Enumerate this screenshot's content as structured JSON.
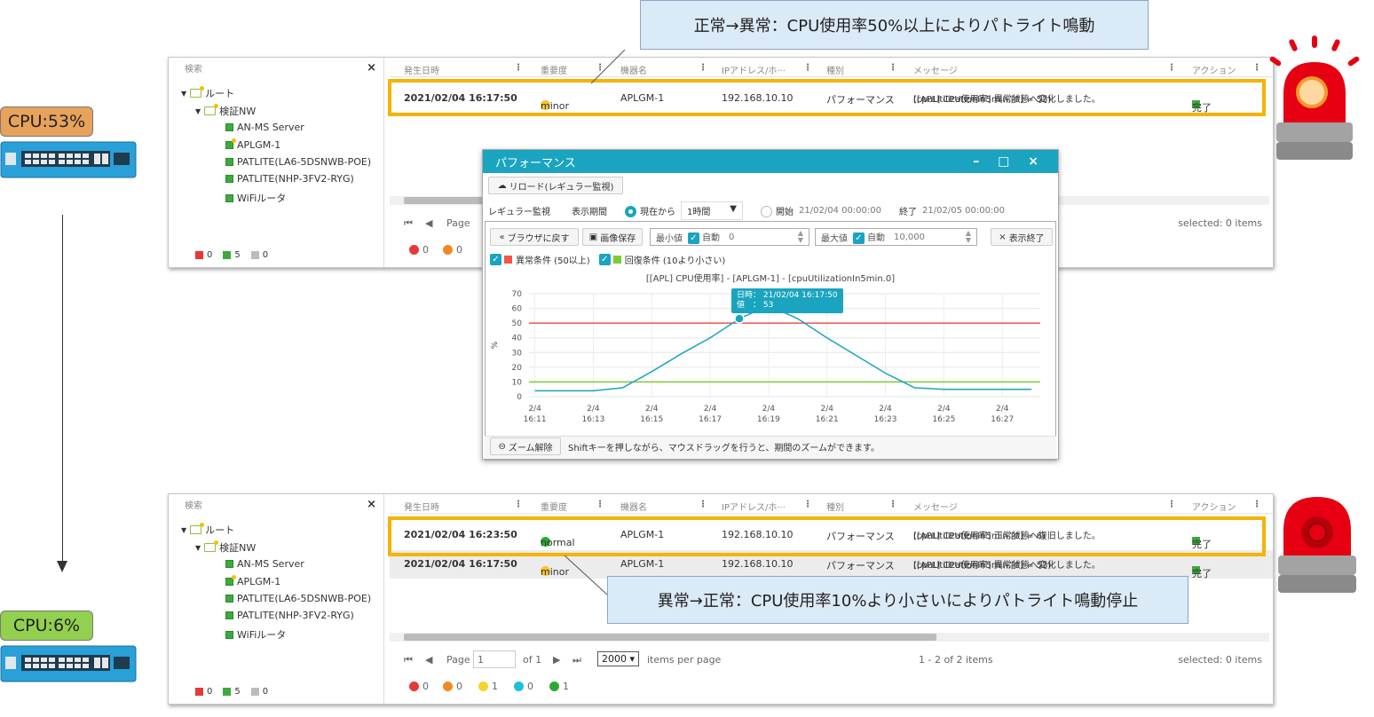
{
  "callout_top": "正常→異常：CPU使用率50%以上によりパトライト鳴動",
  "callout_bottom": "異常→正常：CPU使用率10%より小さいによりパトライト鳴動停止",
  "cpu_top": "CPU:53%",
  "cpu_bottom": "CPU:6%",
  "colors": {
    "cpu_top": "#e7a25c",
    "cpu_bottom": "#92d050",
    "highlight": "#f4b400",
    "accent": "#1aa4c0"
  },
  "tree": {
    "search": "検索",
    "close": "×",
    "root": "ルート",
    "group": "検証NW",
    "items": [
      "AN-MS Server",
      "APLGM-1",
      "PATLITE(LA6-5DSNWB-POE)",
      "PATLITE(NHP-3FV2-RYG)",
      "WiFiルータ"
    ],
    "foot": [
      "0",
      "5",
      "0"
    ]
  },
  "grid": {
    "headers": [
      "発生日時",
      "重要度",
      "機器名",
      "IPアドレス/ホ···",
      "種別",
      "メッセージ",
      "アクション"
    ],
    "col_menu": "⋮"
  },
  "top_row": {
    "datetime": "2021/02/04 16:17:50",
    "severity": "minor",
    "device": "APLGM-1",
    "ip": "192.168.10.10",
    "type": "パフォーマンス",
    "msg1": "[[APL] CPU使用率] 異常状態へ変化しました。",
    "msg2": "(cpuUtilizationIn5min.[0] = 53)",
    "action": "完了"
  },
  "bottom_rows": [
    {
      "datetime": "2021/02/04 16:23:50",
      "severity": "normal",
      "device": "APLGM-1",
      "ip": "192.168.10.10",
      "type": "パフォーマンス",
      "msg1": "[[APL] CPU使用率] 正常状態へ復旧しました。",
      "msg2": "(cpuUtilizationIn5min.[0] = 6)",
      "action": "完了"
    },
    {
      "datetime": "2021/02/04 16:17:50",
      "severity": "minor",
      "device": "APLGM-1",
      "ip": "192.168.10.10",
      "type": "パフォーマンス",
      "msg1": "[[APL] CPU使用率] 異常状態へ変化しました。",
      "msg2": "(cpuUtilizationIn5min.[0] = 53)",
      "action": "完了"
    }
  ],
  "pager": {
    "page_label": "Page",
    "page_value": "1",
    "of_label": "of 1",
    "per_page": "2000",
    "per_page_label": "items per page",
    "count": "1 - 2 of 2 items",
    "selected": "selected: 0 items"
  },
  "status_counts": [
    "0",
    "0",
    "1",
    "0",
    "1"
  ],
  "perf": {
    "title": "パフォーマンス",
    "window_controls": "– □ ×",
    "reload": "リロード(レギュラー監視)",
    "regular": "レギュラー監視",
    "period_label": "表示期間",
    "from_now": "現在から",
    "range": "1時間",
    "start_label": "開始",
    "start": "21/02/04 00:00:00",
    "end_label": "終了",
    "end": "21/02/05 00:00:00",
    "back": "ブラウザに戻す",
    "save_image": "画像保存",
    "min_label": "最小値",
    "auto": "自動",
    "min_value": "0",
    "max_label": "最大値",
    "max_value": "10,000",
    "close_view": "表示終了",
    "cond_abnormal": "異常条件 (50以上)",
    "cond_recover": "回復条件 (10より小さい)",
    "zoom_reset": "ズーム解除",
    "hint": "Shiftキーを押しながら、マウスドラッグを行うと、期間のズームができます。",
    "tooltip": "日時： 21/02/04 16:17:50\n値　： 53"
  },
  "chart_data": {
    "type": "line",
    "title": "[[APL] CPU使用率] - [APLGM-1] - [cpuUtilizationIn5min.0]",
    "ylabel": "%",
    "ylim": [
      0,
      70
    ],
    "yticks": [
      0,
      10,
      20,
      30,
      40,
      50,
      60,
      70
    ],
    "xticks": [
      [
        "2/4",
        "16:11"
      ],
      [
        "2/4",
        "16:13"
      ],
      [
        "2/4",
        "16:15"
      ],
      [
        "2/4",
        "16:17"
      ],
      [
        "2/4",
        "16:19"
      ],
      [
        "2/4",
        "16:21"
      ],
      [
        "2/4",
        "16:23"
      ],
      [
        "2/4",
        "16:25"
      ],
      [
        "2/4",
        "16:27"
      ]
    ],
    "x_minutes": [
      11,
      13,
      15,
      17,
      19,
      21,
      23,
      25,
      27
    ],
    "series": [
      {
        "x": [
          11,
          12,
          13,
          14,
          15,
          16,
          17,
          18,
          19,
          20,
          21,
          22,
          23,
          24,
          25,
          26,
          27,
          28
        ],
        "values": [
          4,
          4,
          4,
          6,
          17,
          29,
          40,
          53,
          62,
          53,
          40,
          28,
          16,
          6,
          5,
          5,
          5,
          5
        ],
        "color": "#1aa4c0"
      }
    ],
    "thresholds": [
      {
        "value": 50,
        "color": "#f0554a"
      },
      {
        "value": 10,
        "color": "#7ecb32"
      }
    ],
    "highlight_point": {
      "x": 18,
      "y": 53
    }
  }
}
